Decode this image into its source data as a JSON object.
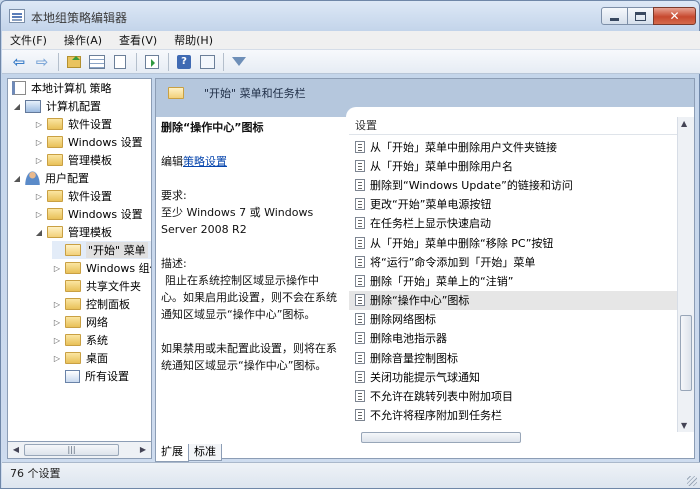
{
  "window": {
    "title": "本地组策略编辑器",
    "close_glyph": "✕"
  },
  "menubar": {
    "items": [
      "文件(F)",
      "操作(A)",
      "查看(V)",
      "帮助(H)"
    ]
  },
  "toolbar": {
    "back": "⇦",
    "forward": "⇨",
    "help": "?"
  },
  "tree": {
    "root": "本地计算机 策略",
    "computer_config": "计算机配置",
    "cc_software": "软件设置",
    "cc_windows": "Windows 设置",
    "cc_admin": "管理模板",
    "user_config": "用户配置",
    "uc_software": "软件设置",
    "uc_windows": "Windows 设置",
    "uc_admin": "管理模板",
    "start_menu": "\"开始\" 菜单",
    "windows_comp": "Windows 组件",
    "shared_folders": "共享文件夹",
    "control_panel": "控制面板",
    "network": "网络",
    "system": "系统",
    "desktop": "桌面",
    "all_settings": "所有设置",
    "scroll_glyph": "|||"
  },
  "header": {
    "title": "\"开始\" 菜单和任务栏"
  },
  "description": {
    "policy_title": "删除“操作中心”图标",
    "edit_prefix": "编辑",
    "edit_link": "策略设置",
    "requirements_label": "要求:",
    "requirements": "至少 Windows 7 或 Windows Server 2008 R2",
    "desc_label": "描述:",
    "desc_text": "阻止在系统控制区域显示操作中心。如果启用此设置，则不会在系统通知区域显示“操作中心”图标。",
    "desc_text2": "如果禁用或未配置此设置，则将在系统通知区域显示“操作中心”图标。"
  },
  "list": {
    "column_header": "设置",
    "items": [
      "从「开始」菜单中删除用户文件夹链接",
      "从「开始」菜单中删除用户名",
      "删除到“Windows Update”的链接和访问",
      "更改“开始”菜单电源按钮",
      "在任务栏上显示快速启动",
      "从「开始」菜单中删除“移除 PC”按钮",
      "将“运行”命令添加到「开始」菜单",
      "删除「开始」菜单上的“注销”",
      "删除“操作中心”图标",
      "删除网络图标",
      "删除电池指示器",
      "删除音量控制图标",
      "关闭功能提示气球通知",
      "不允许在跳转列表中附加项目",
      "不允许将程序附加到任务栏"
    ],
    "selected_index": 8
  },
  "tabs": [
    "扩展",
    "标准"
  ],
  "status": {
    "text": "76 个设置"
  }
}
